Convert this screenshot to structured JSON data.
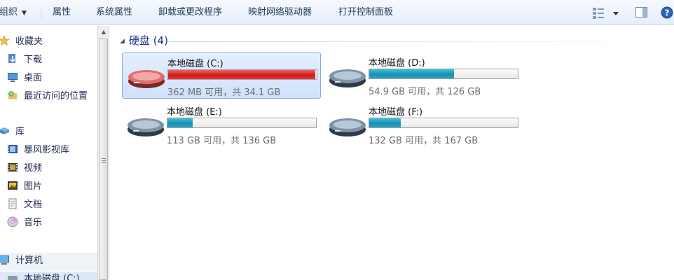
{
  "toolbar": {
    "organize": "组织",
    "properties": "属性",
    "system_properties": "系统属性",
    "uninstall": "卸载或更改程序",
    "map_drive": "映射网络驱动器",
    "control_panel": "打开控制面板"
  },
  "nav": {
    "favorites": "收藏夹",
    "downloads": "下载",
    "desktop": "桌面",
    "recent": "最近访问的位置",
    "libraries": "库",
    "storm": "暴风影视库",
    "videos": "视频",
    "pictures": "图片",
    "documents": "文档",
    "music": "音乐",
    "computer": "计算机",
    "local_disk_c": "本地磁盘 (C:)"
  },
  "main": {
    "group_title": "硬盘 (4)",
    "drives": [
      {
        "name": "本地磁盘 (C:)",
        "free": "362 MB 可用，共 34.1 GB",
        "used_fraction": 0.99,
        "status_color": "#d01a1a"
      },
      {
        "name": "本地磁盘 (D:)",
        "free": "54.9 GB 可用，共 126 GB",
        "used_fraction": 0.57,
        "status_color": "#1b8fb2"
      },
      {
        "name": "本地磁盘 (E:)",
        "free": "113 GB 可用，共 136 GB",
        "used_fraction": 0.17,
        "status_color": "#1b8fb2"
      },
      {
        "name": "本地磁盘 (F:)",
        "free": "132 GB 可用，共 167 GB",
        "used_fraction": 0.21,
        "status_color": "#1b8fb2"
      }
    ]
  },
  "colors": {
    "accent": "#1e3287",
    "selection": "#cfe2fb"
  }
}
